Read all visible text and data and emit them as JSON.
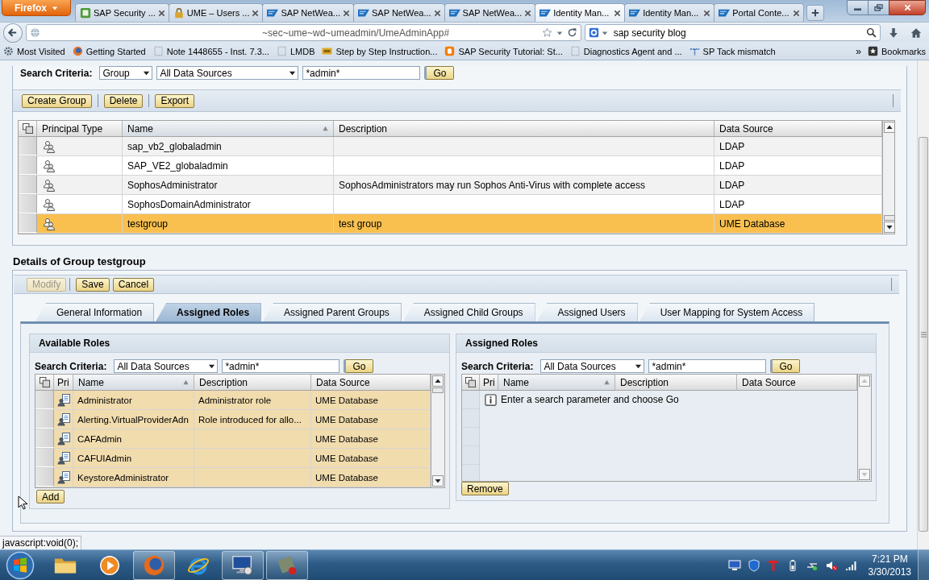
{
  "browser": {
    "menu_button": "Firefox",
    "tabs": [
      {
        "title": "SAP Security ...",
        "kind": "tile",
        "selected": false
      },
      {
        "title": "UME – Users ...",
        "kind": "lock",
        "selected": false
      },
      {
        "title": "SAP NetWea...",
        "kind": "logo",
        "selected": false
      },
      {
        "title": "SAP NetWea...",
        "kind": "logo",
        "selected": false
      },
      {
        "title": "SAP NetWea...",
        "kind": "logo",
        "selected": false
      },
      {
        "title": "Identity Man...",
        "kind": "logo",
        "selected": true
      },
      {
        "title": "Identity Man...",
        "kind": "logo",
        "selected": false
      },
      {
        "title": "Portal Conte...",
        "kind": "logo",
        "selected": false
      }
    ],
    "address": "~sec~ume~wd~umeadmin/UmeAdminApp#",
    "search": "sap security blog",
    "bookmarks": [
      {
        "label": "Most Visited",
        "kind": "gear"
      },
      {
        "label": "Getting Started",
        "kind": "globe"
      },
      {
        "label": "Note 1448655 - Inst. 7.3...",
        "kind": "page"
      },
      {
        "label": "LMDB",
        "kind": "page"
      },
      {
        "label": "Step by Step Instruction...",
        "kind": "badge"
      },
      {
        "label": "SAP Security Tutorial: St...",
        "kind": "blog"
      },
      {
        "label": "Diagnostics Agent and ...",
        "kind": "page"
      },
      {
        "label": "SP Tack mismatch",
        "kind": "pin"
      }
    ],
    "bookmarks_overflow": "»",
    "bookmarks_menu": "Bookmarks"
  },
  "group_search": {
    "label": "Search Criteria:",
    "principal_type": "Group",
    "data_source": "All Data Sources",
    "query": "*admin*",
    "button": "Go"
  },
  "toolbar": [
    {
      "label": "Create Group",
      "disabled": false
    },
    {
      "label": "Delete",
      "disabled": false
    },
    {
      "label": "Export",
      "disabled": false
    }
  ],
  "groups_table": {
    "columns": [
      {
        "label": "Principal Type",
        "sorted": false
      },
      {
        "label": "Name",
        "sorted": true
      },
      {
        "label": "Description",
        "sorted": false
      },
      {
        "label": "Data Source",
        "sorted": false
      }
    ],
    "rows": [
      {
        "name": "sap_vb2_globaladmin",
        "data_source": "LDAP",
        "selected": false
      },
      {
        "name": "SAP_VE2_globaladmin",
        "data_source": "LDAP",
        "selected": false
      },
      {
        "name": "SophosAdministrator",
        "description": "SophosAdministrators may run Sophos Anti-Virus with complete access",
        "data_source": "LDAP",
        "selected": false
      },
      {
        "name": "SophosDomainAdministrator",
        "data_source": "LDAP",
        "selected": false
      },
      {
        "name": "testgroup",
        "description": "test group",
        "data_source": "UME Database",
        "selected": true
      }
    ]
  },
  "details": {
    "title": "Details of Group testgroup",
    "toolbar": [
      {
        "label": "Modify",
        "disabled": true
      },
      {
        "label": "Save",
        "disabled": false
      },
      {
        "label": "Cancel",
        "disabled": false
      }
    ],
    "tabs": [
      {
        "label": "General Information",
        "selected": false
      },
      {
        "label": "Assigned Roles",
        "selected": true
      },
      {
        "label": "Assigned Parent Groups",
        "selected": false
      },
      {
        "label": "Assigned Child Groups",
        "selected": false
      },
      {
        "label": "Assigned Users",
        "selected": false
      },
      {
        "label": "User Mapping for System Access",
        "selected": false
      }
    ],
    "available_roles": {
      "title": "Available Roles",
      "search": {
        "label": "Search Criteria:",
        "data_source": "All Data Sources",
        "query": "*admin*",
        "button": "Go"
      },
      "columns": [
        {
          "label": "Pri",
          "sorted": false
        },
        {
          "label": "Name",
          "sorted": true
        },
        {
          "label": "Description",
          "sorted": false
        },
        {
          "label": "Data Source",
          "sorted": false
        }
      ],
      "rows": [
        {
          "name": "Administrator",
          "description": "Administrator role",
          "data_source": "UME Database",
          "selected": true
        },
        {
          "name": "Alerting.VirtualProviderAdn",
          "description": "Role introduced for allo...",
          "data_source": "UME Database",
          "selected": true
        },
        {
          "name": "CAFAdmin",
          "data_source": "UME Database",
          "selected": true
        },
        {
          "name": "CAFUIAdmin",
          "data_source": "UME Database",
          "selected": true
        },
        {
          "name": "KeystoreAdministrator",
          "data_source": "UME Database",
          "selected": true
        }
      ],
      "action": "Add"
    },
    "assigned_roles": {
      "title": "Assigned Roles",
      "search": {
        "label": "Search Criteria:",
        "data_source": "All Data Sources",
        "query": "*admin*",
        "button": "Go"
      },
      "columns": [
        {
          "label": "Pri",
          "sorted": false
        },
        {
          "label": "Name",
          "sorted": true
        },
        {
          "label": "Description",
          "sorted": false
        },
        {
          "label": "Data Source",
          "sorted": false
        }
      ],
      "message": "Enter a search parameter and choose Go",
      "action": "Remove"
    }
  },
  "status_text": "javascript:void(0);",
  "taskbar": {
    "apps": [
      {
        "kind": "folder",
        "running": false
      },
      {
        "kind": "media",
        "running": false
      },
      {
        "kind": "globe",
        "running": true
      },
      {
        "kind": "ring",
        "running": false
      },
      {
        "kind": "monitor",
        "running": true
      },
      {
        "kind": "app",
        "running": true
      }
    ],
    "tray": [
      {
        "kind": "monitor"
      },
      {
        "kind": "shield"
      },
      {
        "kind": "tee"
      },
      {
        "kind": "battery"
      },
      {
        "kind": "network"
      },
      {
        "kind": "speaker-muted"
      },
      {
        "kind": "signal"
      }
    ],
    "time": "7:21 PM",
    "date": "3/30/2013"
  }
}
